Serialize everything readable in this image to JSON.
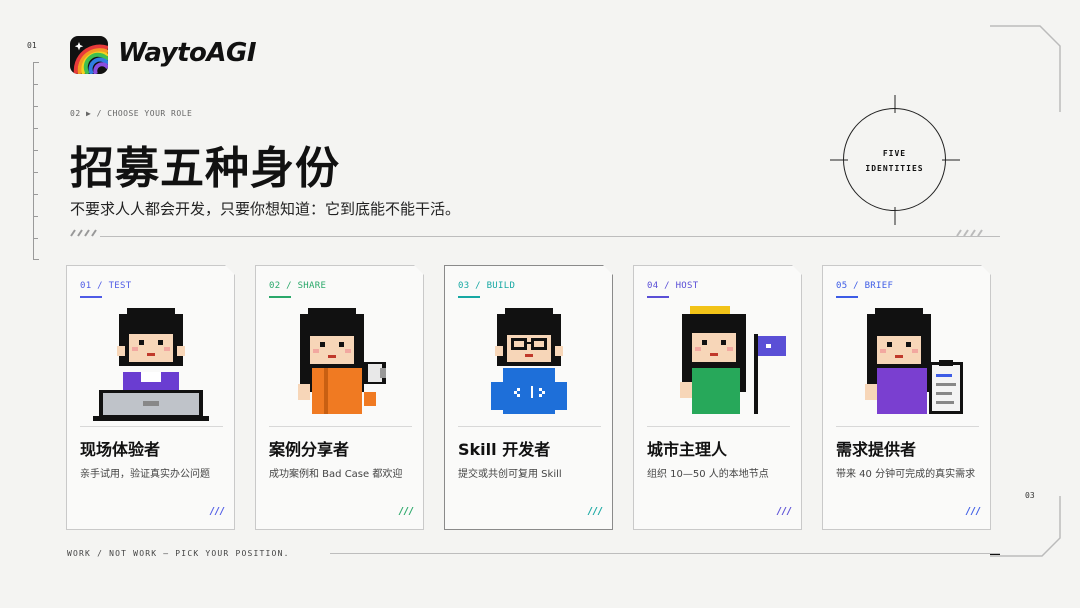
{
  "page": {
    "num_top": "01",
    "num_right": "03",
    "breadcrumb": "02 ▶ / CHOOSE YOUR ROLE",
    "title": "招募五种身份",
    "subtitle": "不要求人人都会开发，只要你想知道：它到底能不能干活。",
    "circle_label_1": "FIVE",
    "circle_label_2": "IDENTITIES",
    "footer": "WORK / NOT WORK — PICK YOUR POSITION."
  },
  "brand": {
    "name": "WaytoAGI"
  },
  "cards": [
    {
      "tag": "01 / TEST",
      "title": "现场体验者",
      "desc": "亲手试用，验证真实办公问题",
      "slash": "///",
      "accent": "#4f5be6"
    },
    {
      "tag": "02 / SHARE",
      "title": "案例分享者",
      "desc": "成功案例和 Bad Case 都欢迎",
      "slash": "///",
      "accent": "#2aa86a"
    },
    {
      "tag": "03 / BUILD",
      "title": "Skill 开发者",
      "desc": "提交或共创可复用 Skill",
      "slash": "///",
      "accent": "#17a8a3"
    },
    {
      "tag": "04 / HOST",
      "title": "城市主理人",
      "desc": "组织 10—50 人的本地节点",
      "slash": "///",
      "accent": "#5a4fd6"
    },
    {
      "tag": "05 / BRIEF",
      "title": "需求提供者",
      "desc": "带来 40 分钟可完成的真实需求",
      "slash": "///",
      "accent": "#3d5ce6"
    }
  ]
}
